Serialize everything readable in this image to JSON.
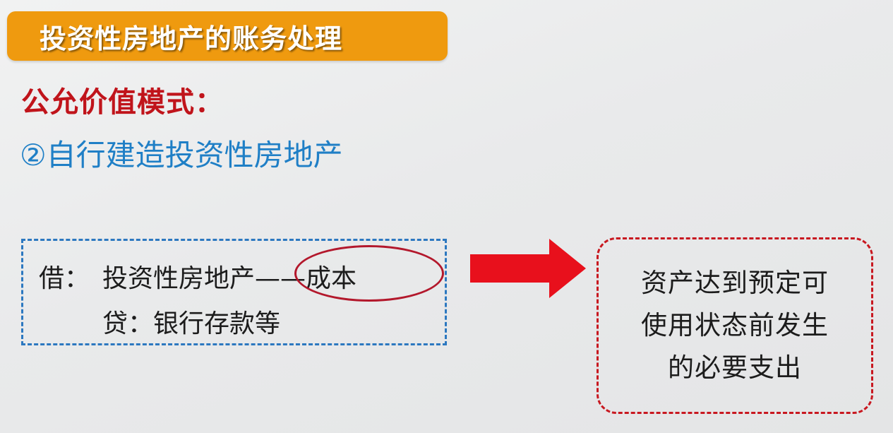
{
  "title": "投资性房地产的账务处理",
  "mode_label": "公允价值模式：",
  "sub_heading": "②自行建造投资性房地产",
  "journal_entry": {
    "debit_label": "借：",
    "debit_account_prefix": "投资性房地产",
    "debit_account_highlight": "——成本",
    "credit_text": "贷：银行存款等"
  },
  "note": {
    "lines": [
      "资产达到预定可",
      "使用状态前发生",
      "的必要支出"
    ]
  },
  "colors": {
    "title_bar": "#ef9a0f",
    "mode_label": "#c0141b",
    "sub_heading": "#1f7fc6",
    "entry_border": "#2c78c0",
    "arrow": "#e8101c",
    "note_border": "#c81820",
    "highlight_oval": "#b3182c"
  },
  "icons": {
    "arrow": "right-arrow-icon"
  }
}
